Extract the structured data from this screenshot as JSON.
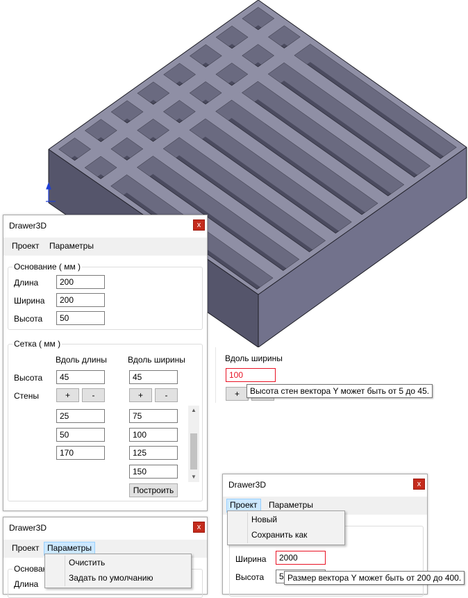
{
  "main_window": {
    "title": "Drawer3D",
    "close_label": "x",
    "menu": {
      "project": "Проект",
      "params": "Параметры"
    },
    "base": {
      "title": "Основание ( мм )",
      "length_label": "Длина",
      "length_value": "200",
      "width_label": "Ширина",
      "width_value": "200",
      "height_label": "Высота",
      "height_value": "50"
    },
    "grid": {
      "title": "Сетка ( мм )",
      "col_length": "Вдоль длины",
      "col_width": "Вдоль ширины",
      "height_label": "Высота",
      "height_length_value": "45",
      "height_width_value": "45",
      "walls_label": "Стены",
      "plus": "+",
      "minus": "-",
      "walls_length": [
        "25",
        "50",
        "170"
      ],
      "walls_width": [
        "75",
        "100",
        "125",
        "150"
      ],
      "build_button": "Построить"
    }
  },
  "tooltip_panel": {
    "col_label": "Вдоль ширины",
    "value": "100",
    "plus": "+",
    "tooltip": "Высота стен вектора Y может быть от 5 до 45."
  },
  "params_window": {
    "title": "Drawer3D",
    "close_label": "x",
    "menu": {
      "project": "Проект",
      "params": "Параметры"
    },
    "dropdown": [
      "Очистить",
      "Задать по умолчанию"
    ],
    "base_title": "Основание",
    "length_label": "Длина"
  },
  "project_window": {
    "title": "Drawer3D",
    "close_label": "x",
    "menu": {
      "project": "Проект",
      "params": "Параметры"
    },
    "dropdown": [
      "Новый",
      "Сохранить как"
    ],
    "width_label": "Ширина",
    "width_value": "2000",
    "height_label": "Высота",
    "height_value": "50",
    "tooltip": "Размер вектора Y может быть от 200 до 400."
  },
  "colors": {
    "model_top": "#8f8fa5",
    "model_left": "#55556b",
    "model_right": "#70708a",
    "error": "#e81123",
    "close": "#c42b1c"
  }
}
